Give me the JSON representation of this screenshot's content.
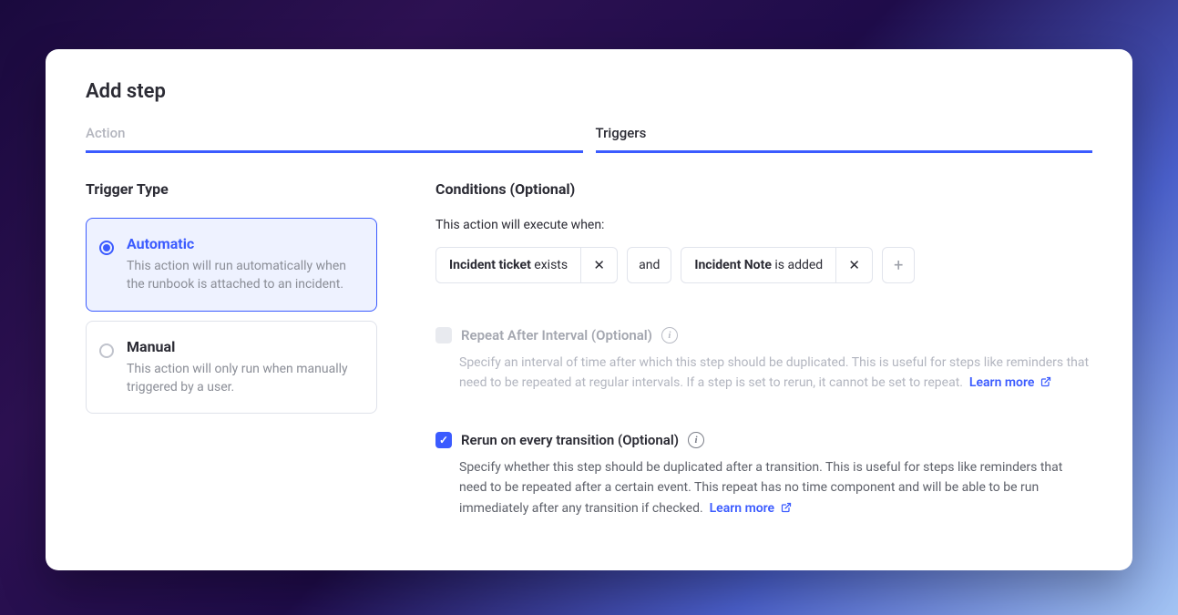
{
  "title": "Add step",
  "tabs": {
    "action": "Action",
    "triggers": "Triggers"
  },
  "triggerType": {
    "heading": "Trigger Type",
    "automatic": {
      "title": "Automatic",
      "desc": "This action will run automatically when the runbook is attached to an incident."
    },
    "manual": {
      "title": "Manual",
      "desc": "This action will only run when manually triggered by a user."
    }
  },
  "conditions": {
    "heading": "Conditions (Optional)",
    "lead": "This action will execute when:",
    "chip1_bold": "Incident ticket",
    "chip1_rest": " exists",
    "operator": "and",
    "chip2_bold": "Incident Note",
    "chip2_rest": " is added"
  },
  "repeat": {
    "label": "Repeat After Interval (Optional)",
    "desc_text": "Specify an interval of time after which this step should be duplicated. This is useful for steps like reminders that need to be repeated at regular intervals. If a step is set to rerun, it cannot be set to repeat.",
    "learn": "Learn more"
  },
  "rerun": {
    "label": "Rerun on every transition (Optional)",
    "desc_text": "Specify whether this step should be duplicated after a transition. This is useful for steps like reminders that need to be repeated after a certain event. This repeat has no time component and will be able to be run immediately after any transition if checked.",
    "learn": "Learn more"
  }
}
